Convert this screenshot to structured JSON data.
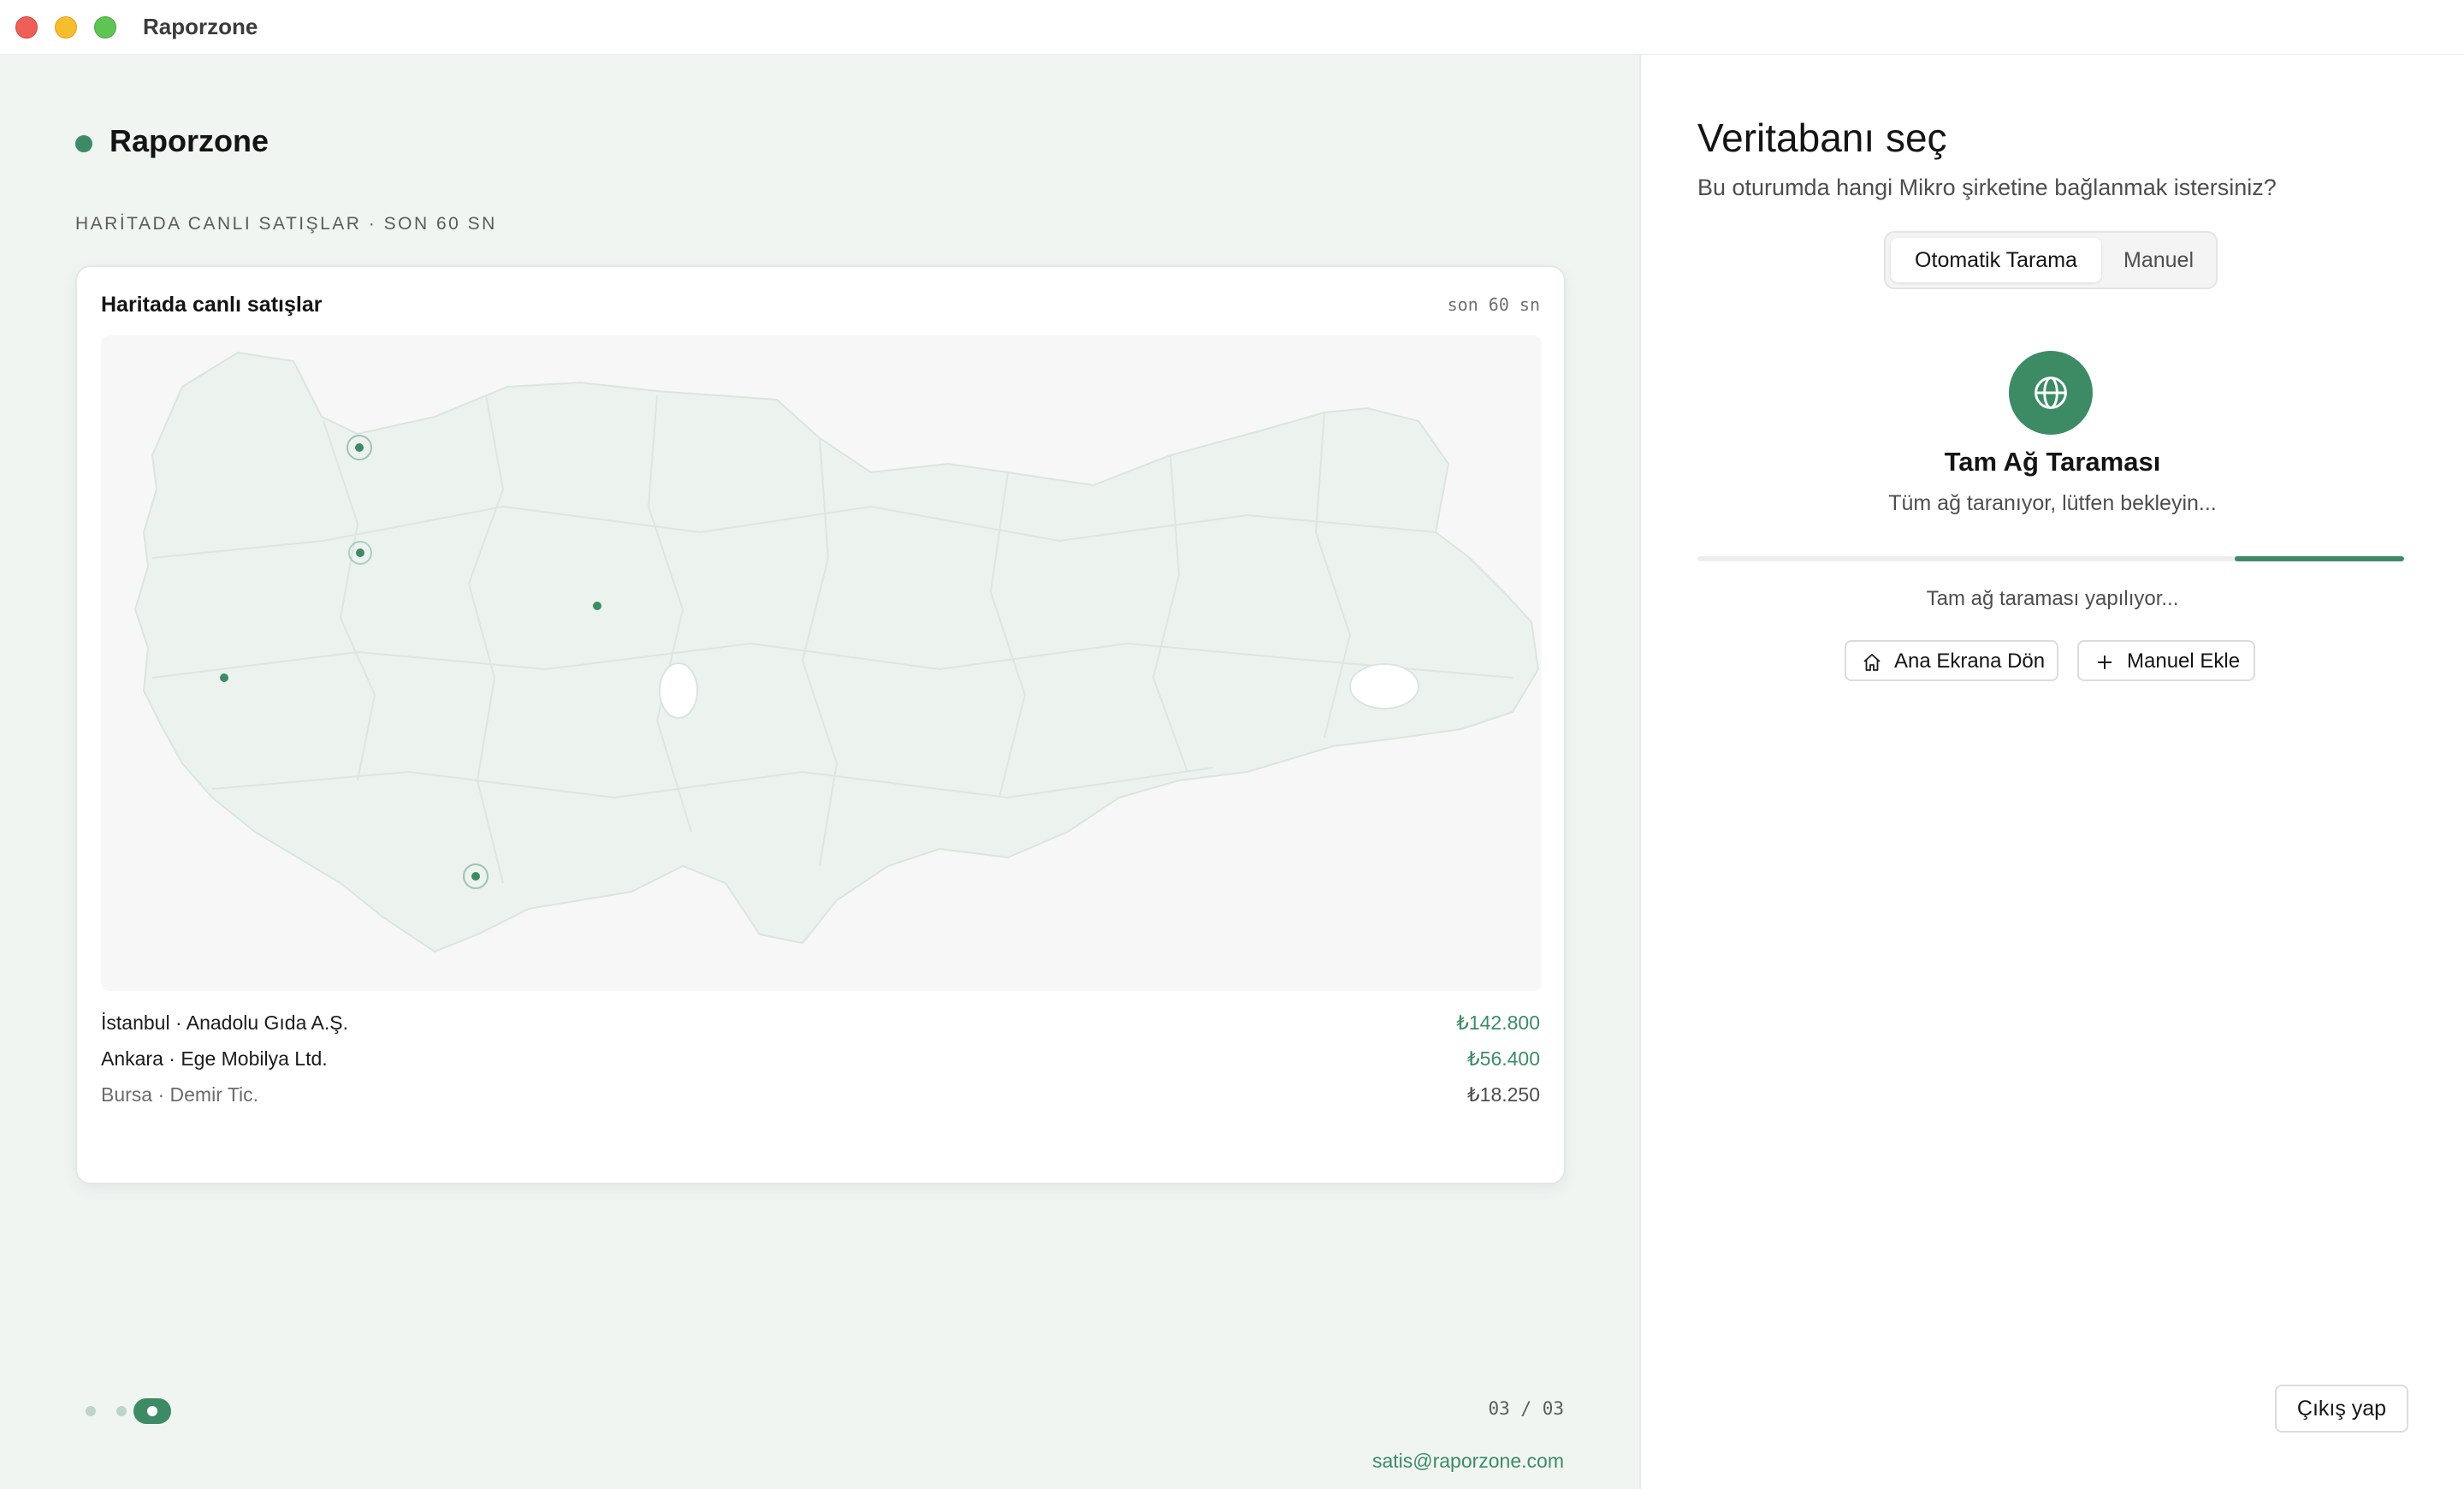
{
  "window": {
    "title": "Raporzone"
  },
  "left": {
    "brand": "Raporzone",
    "section_label": "HARİTADA CANLI SATIŞLAR · SON 60 SN",
    "card": {
      "title": "Haritada canlı satışlar",
      "meta": "son 60 sn",
      "sales": [
        {
          "name": "İstanbul · Anadolu Gıda A.Ş.",
          "amount": "₺142.800",
          "color": "#3d8b65"
        },
        {
          "name": "Ankara · Ege Mobilya Ltd.",
          "amount": "₺56.400",
          "color": "#3d8b65"
        },
        {
          "name": "Bursa · Demir Tic.",
          "amount": "₺18.250",
          "color": "#6b6b6b"
        }
      ]
    },
    "pager": "03 / 03",
    "email": "satis@raporzone.com"
  },
  "right": {
    "title": "Veritabanı seç",
    "subtitle": "Bu oturumda hangi Mikro şirketine bağlanmak istersiniz?",
    "tabs": {
      "active": "Otomatik Tarama",
      "inactive": "Manuel"
    },
    "scan": {
      "icon": "globe-icon",
      "title": "Tam Ağ Taraması",
      "subtitle": "Tüm ağ taranıyor, lütfen bekleyin...",
      "progress_start": 0.76,
      "progress_end": 1.0,
      "status": "Tam ağ taraması yapılıyor..."
    },
    "buttons": {
      "home": "Ana Ekrana Dön",
      "add": "Manuel Ekle"
    },
    "logout": "Çıkış yap"
  },
  "colors": {
    "accent": "#3d8b65",
    "left_bg": "#f0f5f2"
  }
}
